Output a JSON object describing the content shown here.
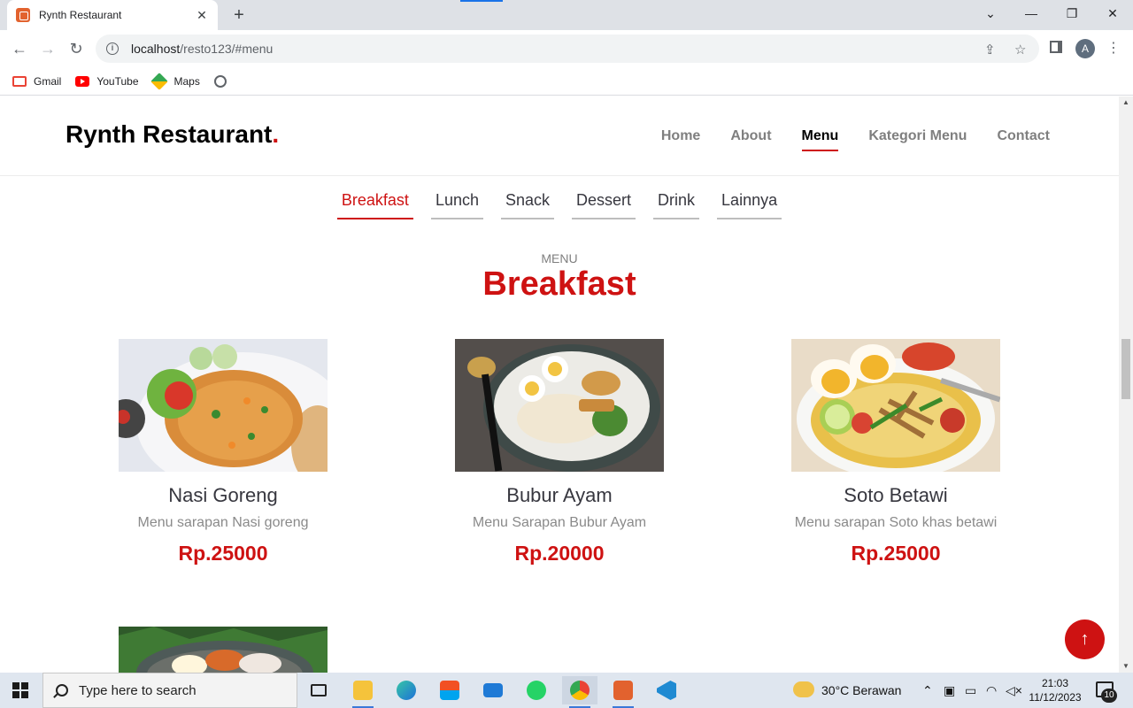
{
  "browser": {
    "tab_title": "Rynth Restaurant",
    "tab_close": "✕",
    "new_tab": "+",
    "url_host": "localhost",
    "url_path": "/resto123/#menu",
    "bookmarks": [
      {
        "label": "Gmail"
      },
      {
        "label": "YouTube"
      },
      {
        "label": "Maps"
      }
    ],
    "profile_initial": "A"
  },
  "site": {
    "logo_text": "Rynth Restaurant",
    "logo_dot": ".",
    "nav": [
      {
        "label": "Home",
        "active": false
      },
      {
        "label": "About",
        "active": false
      },
      {
        "label": "Menu",
        "active": true
      },
      {
        "label": "Kategori Menu",
        "active": false
      },
      {
        "label": "Contact",
        "active": false
      }
    ],
    "category_tabs": [
      {
        "label": "Breakfast",
        "active": true
      },
      {
        "label": "Lunch",
        "active": false
      },
      {
        "label": "Snack",
        "active": false
      },
      {
        "label": "Dessert",
        "active": false
      },
      {
        "label": "Drink",
        "active": false
      },
      {
        "label": "Lainnya",
        "active": false
      }
    ],
    "section_subtitle": "Menu",
    "section_title": "Breakfast",
    "items": [
      {
        "name": "Nasi Goreng",
        "description": "Menu sarapan Nasi goreng",
        "price": "Rp.25000"
      },
      {
        "name": "Bubur Ayam",
        "description": "Menu Sarapan Bubur Ayam",
        "price": "Rp.20000"
      },
      {
        "name": "Soto Betawi",
        "description": "Menu sarapan Soto khas betawi",
        "price": "Rp.25000"
      }
    ],
    "back_to_top_icon": "arrow-up-icon"
  },
  "taskbar": {
    "search_placeholder": "Type here to search",
    "weather": "30°C  Berawan",
    "time": "21:03",
    "date": "11/12/2023",
    "notification_count": "10"
  },
  "colors": {
    "accent": "#ce1212",
    "nav_inactive": "#7f7f7f",
    "text_dark": "#37373f"
  }
}
